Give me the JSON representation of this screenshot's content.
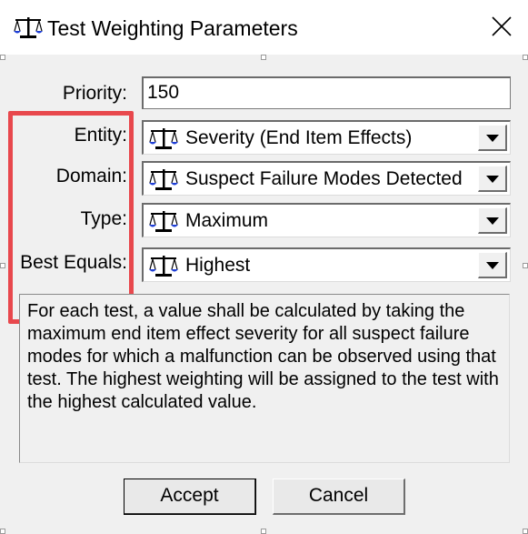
{
  "window": {
    "title": "Test Weighting Parameters",
    "icon": "balance-scale-icon",
    "close_icon": "close-icon"
  },
  "fields": {
    "priority": {
      "label": "Priority:",
      "value": "150"
    },
    "entity": {
      "label": "Entity:",
      "value": "Severity (End Item Effects)",
      "icon": "balance-scale-icon"
    },
    "domain": {
      "label": "Domain:",
      "value": "Suspect Failure Modes Detected",
      "icon": "balance-scale-icon"
    },
    "type": {
      "label": "Type:",
      "value": "Maximum",
      "icon": "balance-scale-icon"
    },
    "best_equals": {
      "label": "Best Equals:",
      "value": "Highest",
      "icon": "balance-scale-icon"
    }
  },
  "description": "For each test, a value shall be calculated by taking the maximum end item effect severity for all suspect failure modes for which a malfunction can be observed using that test. The highest weighting will be assigned to the test with the highest calculated value.",
  "buttons": {
    "accept": "Accept",
    "cancel": "Cancel"
  },
  "colors": {
    "highlight": "#e8484d",
    "icon_blue": "#1f3fd6",
    "dialog_bg": "#f0f0f0"
  }
}
